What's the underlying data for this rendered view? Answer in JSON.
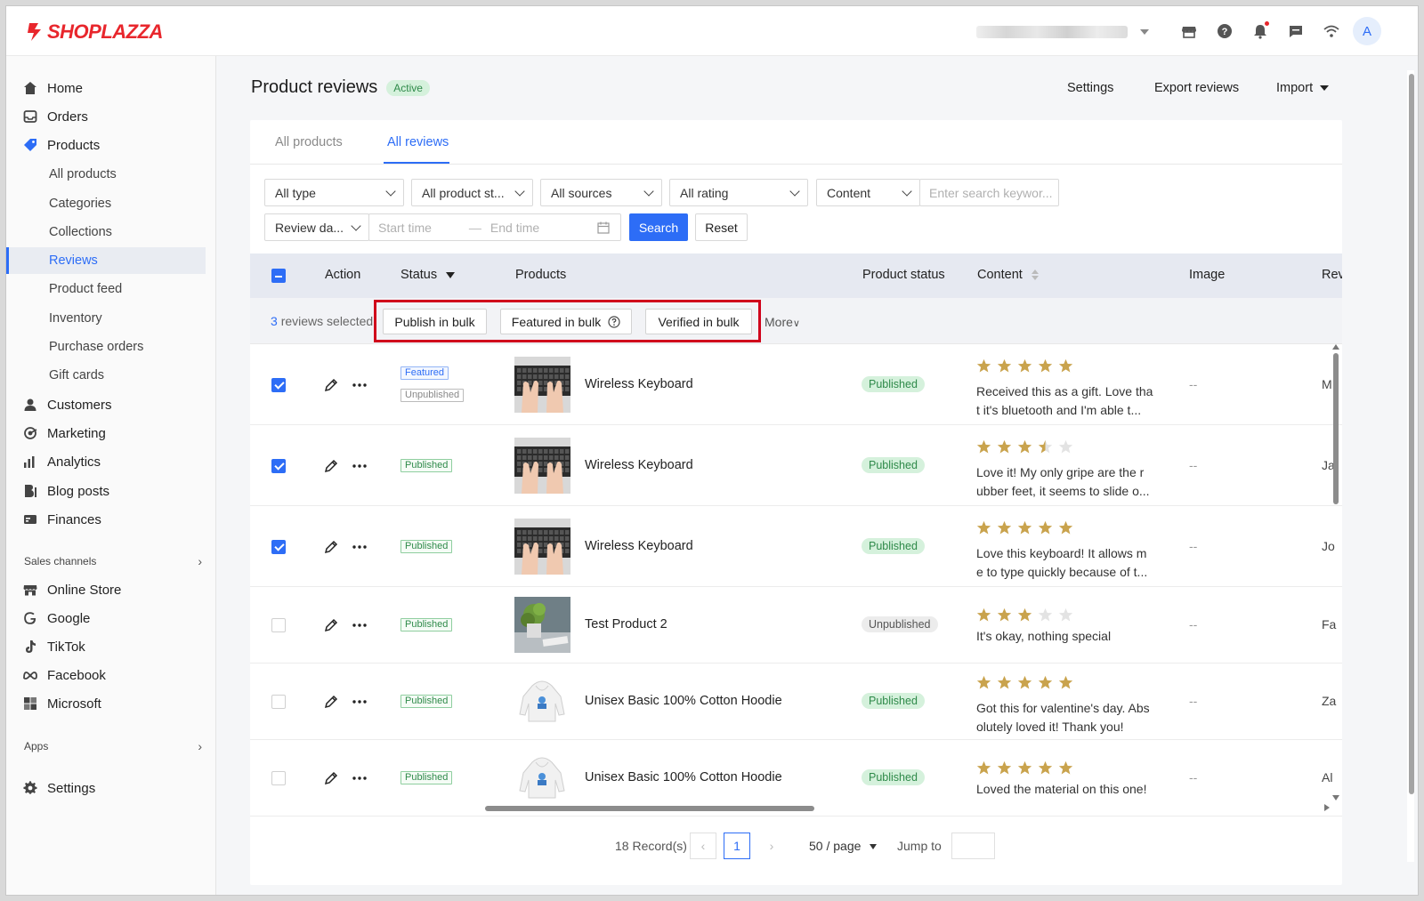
{
  "app": {
    "logo_text": "SHOPLAZZA",
    "brand_color": "#e8262c",
    "accent_color": "#2d6df6",
    "avatar_letter": "A"
  },
  "topbar": {
    "icons": [
      "store-icon",
      "help-icon",
      "bell-icon",
      "message-icon",
      "wifi-icon"
    ]
  },
  "sidebar": {
    "items": [
      {
        "label": "Home",
        "icon": "home-icon"
      },
      {
        "label": "Orders",
        "icon": "orders-icon"
      },
      {
        "label": "Products",
        "icon": "tag-icon"
      }
    ],
    "product_subitems": [
      "All products",
      "Categories",
      "Collections",
      "Reviews",
      "Product feed",
      "Inventory",
      "Purchase orders",
      "Gift cards"
    ],
    "items2": [
      {
        "label": "Customers",
        "icon": "person-icon"
      },
      {
        "label": "Marketing",
        "icon": "marketing-icon"
      },
      {
        "label": "Analytics",
        "icon": "analytics-icon"
      },
      {
        "label": "Blog posts",
        "icon": "blog-icon"
      },
      {
        "label": "Finances",
        "icon": "finances-icon"
      }
    ],
    "sales_channels_label": "Sales channels",
    "channels": [
      {
        "label": "Online Store",
        "icon": "store-icon"
      },
      {
        "label": "Google",
        "icon": "google-icon"
      },
      {
        "label": "TikTok",
        "icon": "tiktok-icon"
      },
      {
        "label": "Facebook",
        "icon": "facebook-icon"
      },
      {
        "label": "Microsoft",
        "icon": "microsoft-icon"
      }
    ],
    "apps_label": "Apps",
    "settings_label": "Settings"
  },
  "header": {
    "title": "Product reviews",
    "badge": "Active",
    "settings": "Settings",
    "export": "Export reviews",
    "import": "Import"
  },
  "tabs": [
    "All products",
    "All reviews"
  ],
  "filters": {
    "type": "All type",
    "product_status": "All product st...",
    "sources": "All sources",
    "rating": "All rating",
    "content": "Content",
    "search_placeholder": "Enter search keywor...",
    "review_date": "Review da...",
    "start_placeholder": "Start time",
    "end_placeholder": "End time",
    "search_button": "Search",
    "reset_button": "Reset"
  },
  "table": {
    "columns": {
      "action": "Action",
      "status": "Status",
      "products": "Products",
      "product_status": "Product status",
      "content": "Content",
      "image": "Image",
      "reviewer": "Rev"
    },
    "bulk": {
      "count": "3",
      "suffix": "reviews selected",
      "publish": "Publish in bulk",
      "featured": "Featured in bulk",
      "verified": "Verified in bulk",
      "more": "More"
    },
    "rows": [
      {
        "checked": true,
        "tags": [
          "Featured",
          "Unpublished"
        ],
        "product": "Wireless Keyboard",
        "thumb": "keyboard",
        "product_status": "Published",
        "rating": 5,
        "content": "Received this as a gift. Love tha t it's bluetooth and I'm able t...",
        "image": "--",
        "reviewer": "M"
      },
      {
        "checked": true,
        "tags": [
          "Published"
        ],
        "product": "Wireless Keyboard",
        "thumb": "keyboard",
        "product_status": "Published",
        "rating": 3.5,
        "content": "Love it! My only gripe are the r ubber feet, it seems to slide o...",
        "image": "--",
        "reviewer": "Ja"
      },
      {
        "checked": true,
        "tags": [
          "Published"
        ],
        "product": "Wireless Keyboard",
        "thumb": "keyboard",
        "product_status": "Published",
        "rating": 5,
        "content": "Love this keyboard! It allows m e to type quickly because of t...",
        "image": "--",
        "reviewer": "Jo"
      },
      {
        "checked": false,
        "tags": [
          "Published"
        ],
        "product": "Test Product 2",
        "thumb": "plant",
        "product_status": "Unpublished",
        "rating": 3,
        "content": "It's okay, nothing special",
        "image": "--",
        "reviewer": "Fa"
      },
      {
        "checked": false,
        "tags": [
          "Published"
        ],
        "product": "Unisex Basic 100% Cotton Hoodie",
        "thumb": "hoodie",
        "product_status": "Published",
        "rating": 5,
        "content": "Got this for valentine's day. Abs olutely loved it! Thank you!",
        "image": "--",
        "reviewer": "Za"
      },
      {
        "checked": false,
        "tags": [
          "Published"
        ],
        "product": "Unisex Basic 100% Cotton Hoodie",
        "thumb": "hoodie",
        "product_status": "Published",
        "rating": 5,
        "content": "Loved the material on this one!",
        "image": "--",
        "reviewer": "Al"
      }
    ]
  },
  "pagination": {
    "records": "18 Record(s)",
    "current_page": "1",
    "page_size": "50 / page",
    "jump_label": "Jump to"
  }
}
